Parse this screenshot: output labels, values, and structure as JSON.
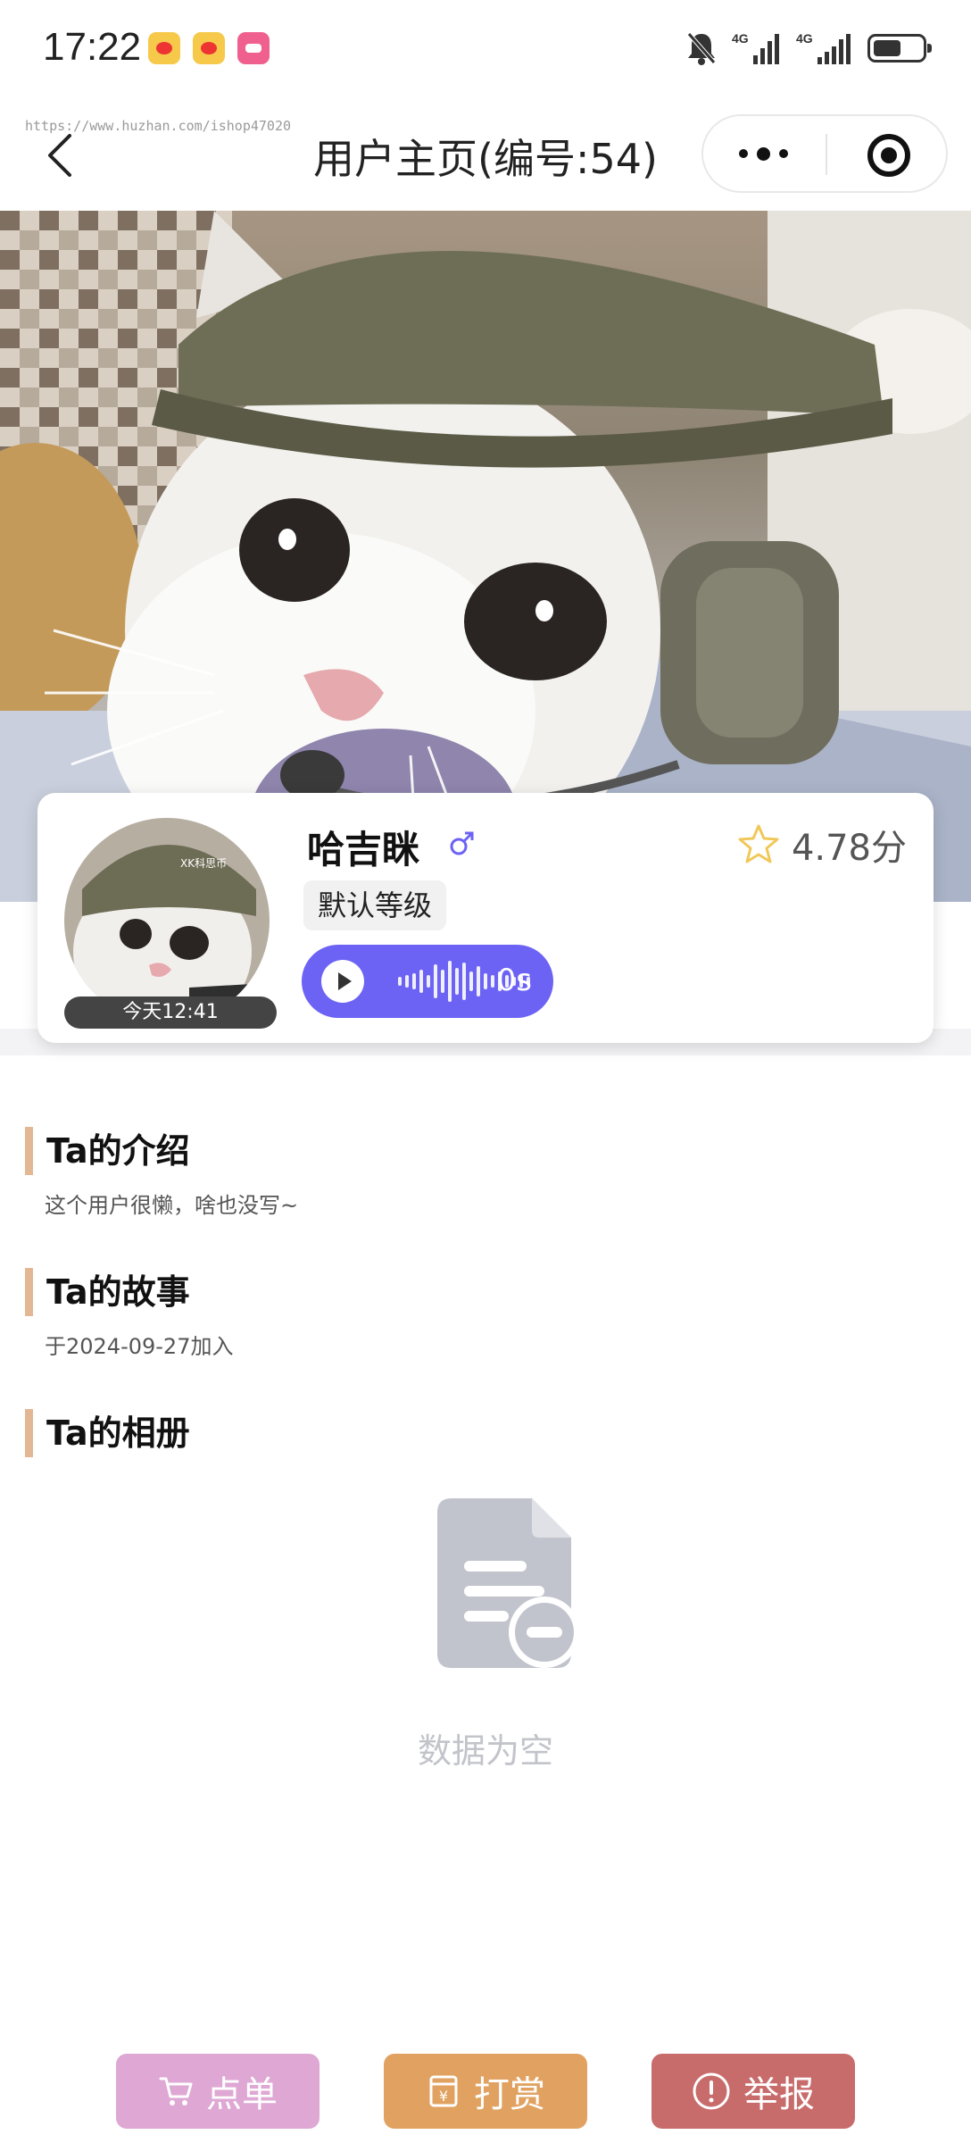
{
  "status_bar": {
    "time": "17:22",
    "notification_icons": [
      "weibo-icon",
      "weibo-icon",
      "bilibili-icon"
    ],
    "network_1": "4G",
    "network_2": "4G"
  },
  "nav": {
    "watermark": "https://www.huzhan.com/ishop47020",
    "title": "用户主页(编号:54)"
  },
  "profile": {
    "name": "哈吉眯",
    "gender": "male",
    "level": "默认等级",
    "rating": "4.78分",
    "avatar_caption": "XK科思币",
    "last_active": "今天12:41",
    "voice_duration": "0s"
  },
  "sections": {
    "intro_title": "Ta的介绍",
    "intro_text": "这个用户很懒，啥也没写~",
    "story_title": "Ta的故事",
    "story_text": "于2024-09-27加入",
    "album_title": "Ta的相册",
    "album_empty": "数据为空"
  },
  "actions": {
    "order": "点单",
    "tip": "打赏",
    "report": "举报"
  },
  "colors": {
    "voice": "#6c63f5",
    "accent_bar": "#e2b894",
    "order": "#dea7d4",
    "tip": "#e1a261",
    "report": "#c86b6b"
  }
}
